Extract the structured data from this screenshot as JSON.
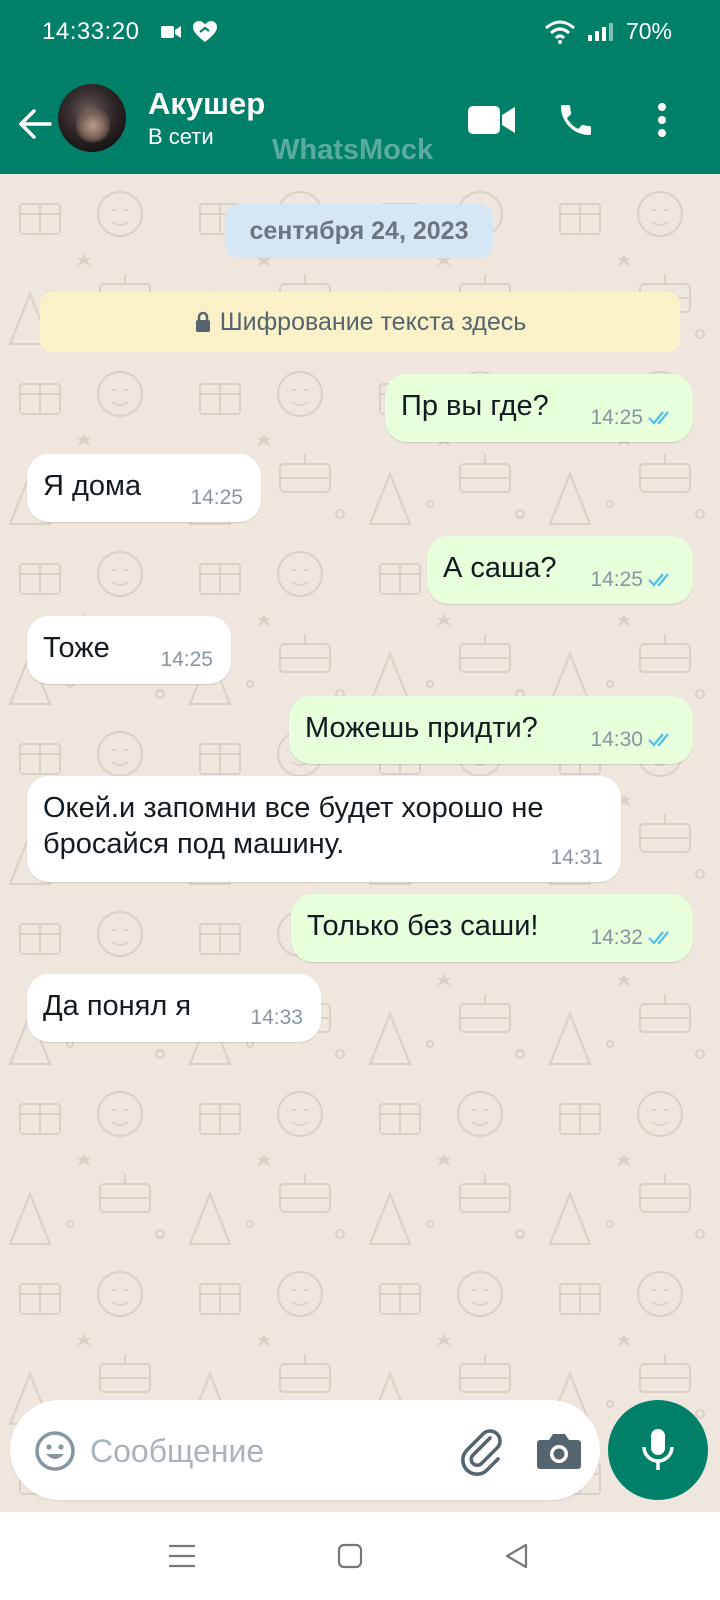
{
  "status_bar": {
    "time": "14:33:20",
    "battery": "70%"
  },
  "header": {
    "contact_name": "Акушер",
    "contact_status": "В сети",
    "watermark": "WhatsMock"
  },
  "chat": {
    "date": "сентября 24, 2023",
    "encryption_notice": "Шифрование текста здесь",
    "messages": [
      {
        "direction": "out",
        "text": "Пр вы где?",
        "time": "14:25",
        "status": "read"
      },
      {
        "direction": "in",
        "text": "Я дома",
        "time": "14:25"
      },
      {
        "direction": "out",
        "text": "А саша?",
        "time": "14:25",
        "status": "read"
      },
      {
        "direction": "in",
        "text": "Тоже",
        "time": "14:25"
      },
      {
        "direction": "out",
        "text": "Можешь придти?",
        "time": "14:30",
        "status": "read"
      },
      {
        "direction": "in",
        "text": "Окей.и запомни все будет хорошо не бросайся под машину.",
        "time": "14:31"
      },
      {
        "direction": "out",
        "text": "Только без саши!",
        "time": "14:32",
        "status": "read"
      },
      {
        "direction": "in",
        "text": "Да понял я",
        "time": "14:33"
      }
    ]
  },
  "composer": {
    "placeholder": "Сообщение"
  },
  "icons": {
    "video_call": "video-camera-icon",
    "voice_call": "phone-icon",
    "menu": "more-vertical-icon",
    "emoji": "emoji-icon",
    "attach": "paperclip-icon",
    "camera": "camera-icon",
    "mic": "microphone-icon",
    "lock": "lock-icon"
  },
  "colors": {
    "header": "#008069",
    "outgoing_bubble": "#e7ffdb",
    "incoming_bubble": "#ffffff",
    "read_tick": "#53bdeb"
  }
}
